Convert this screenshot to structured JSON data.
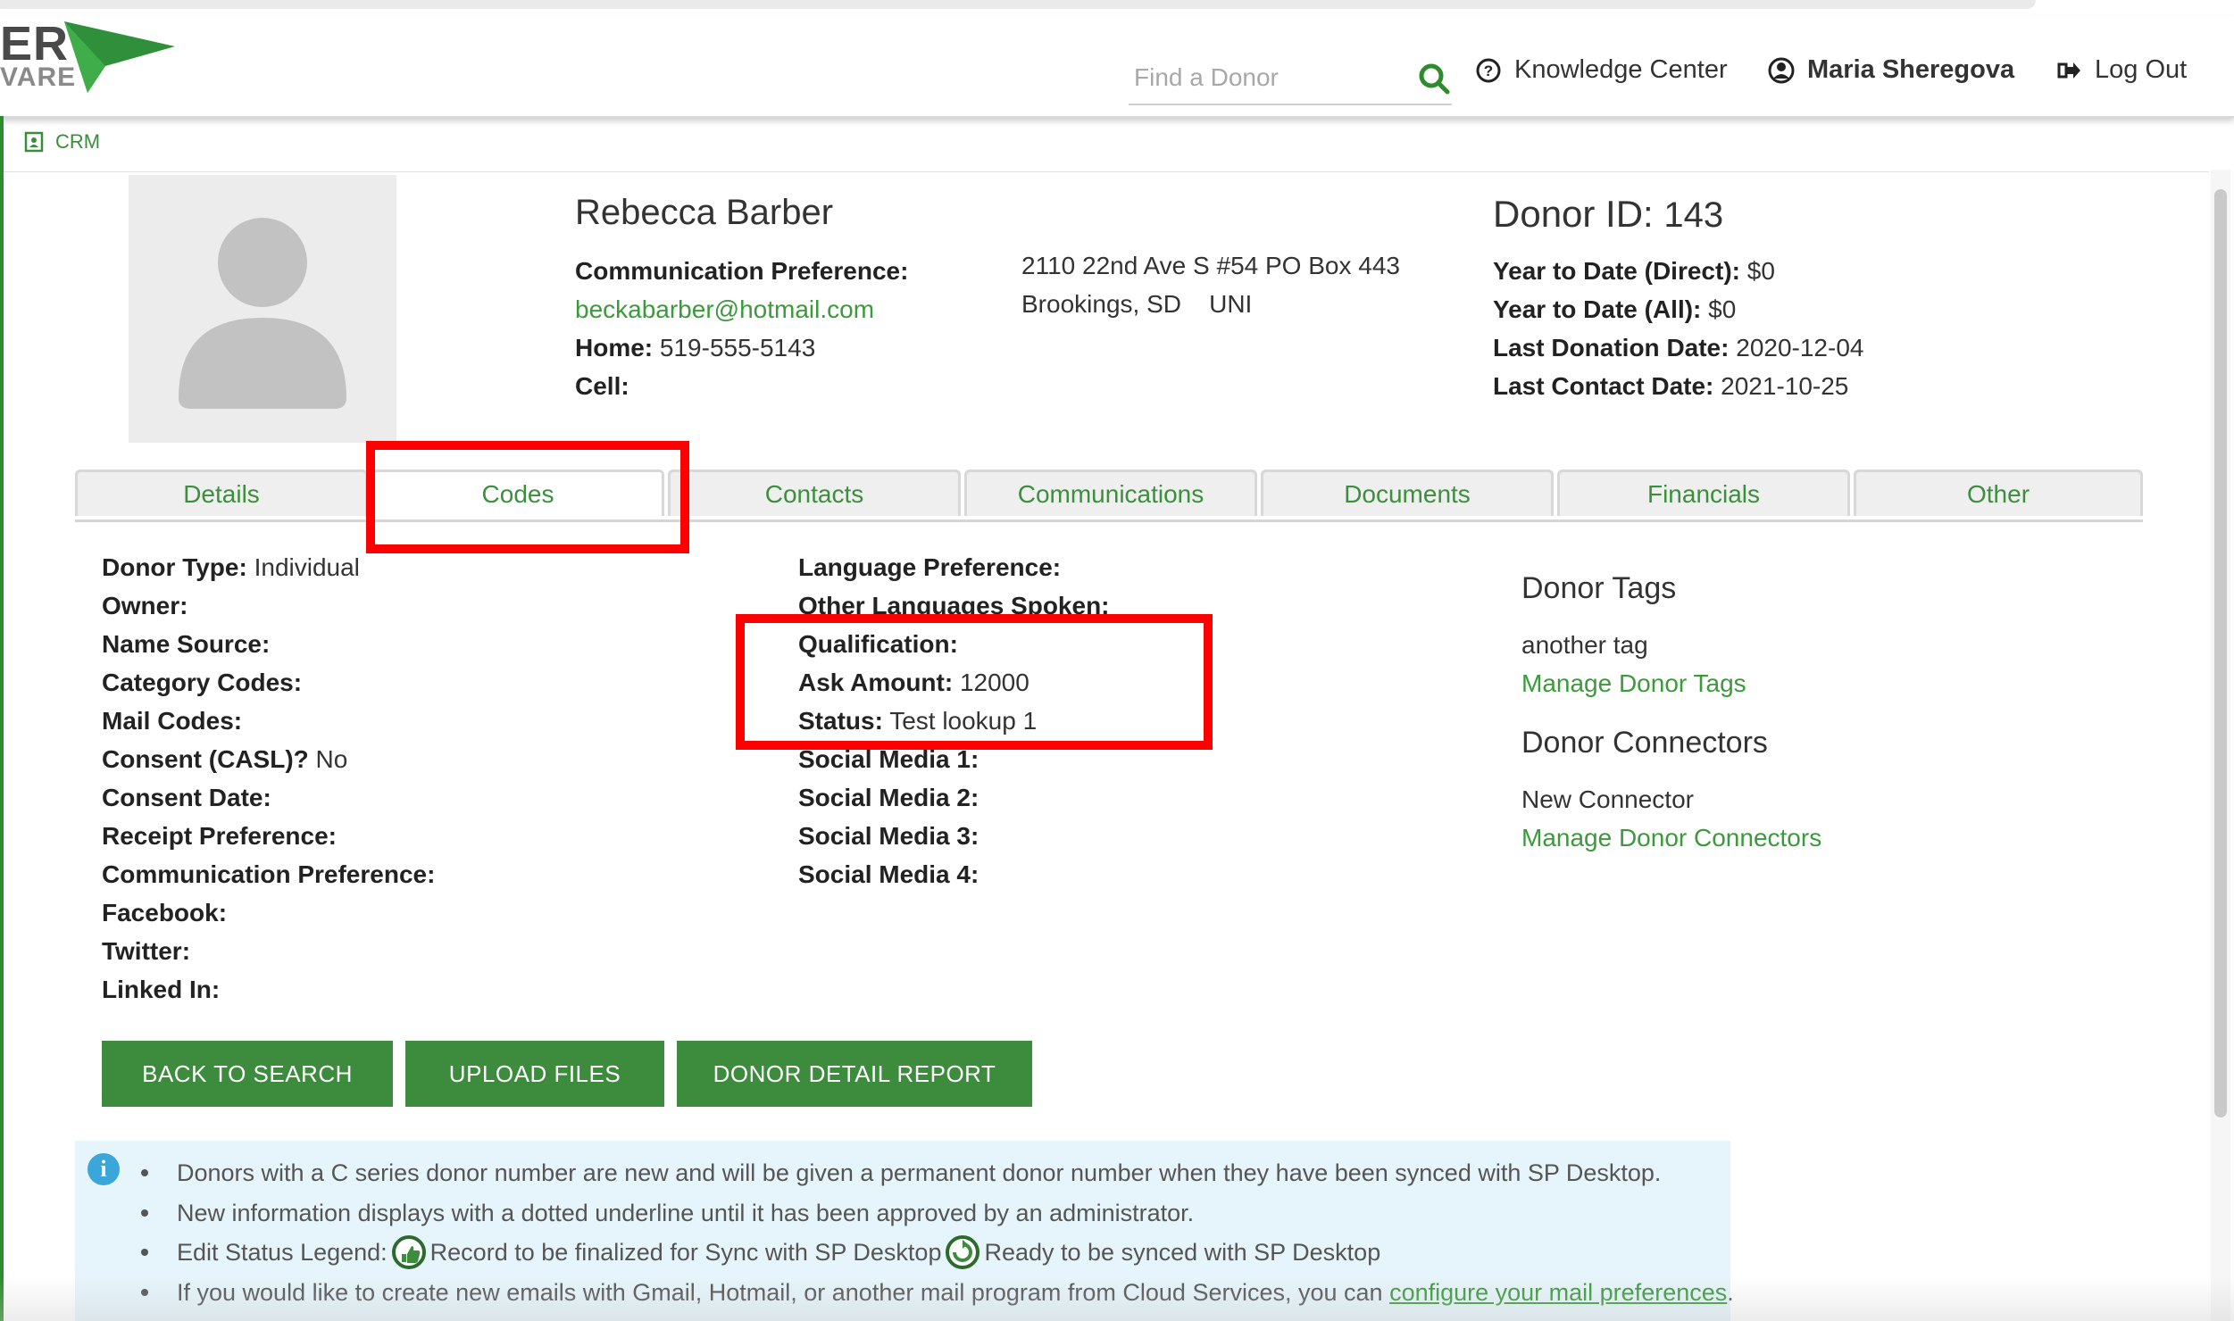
{
  "header": {
    "logo_line1": "ER",
    "logo_line2": "VARE",
    "search_placeholder": "Find a Donor",
    "knowledge_center": "Knowledge Center",
    "user_name": "Maria Sheregova",
    "logout": "Log Out"
  },
  "breadcrumb": {
    "label": "CRM"
  },
  "donor": {
    "name": "Rebecca Barber",
    "comm_pref_label": "Communication Preference:",
    "email": "beckabarber@hotmail.com",
    "home_label": "Home:",
    "home": "519-555-5143",
    "cell_label": "Cell:",
    "address_line1": "2110 22nd Ave S #54 PO Box 443",
    "address_city": "Brookings, SD",
    "address_country": "UNI",
    "id_label": "Donor ID:",
    "id": "143",
    "ytd_direct_label": "Year to Date (Direct):",
    "ytd_direct": "$0",
    "ytd_all_label": "Year to Date (All):",
    "ytd_all": "$0",
    "last_donation_label": "Last Donation Date:",
    "last_donation": "2020-12-04",
    "last_contact_label": "Last Contact Date:",
    "last_contact": "2021-10-25"
  },
  "tabs": [
    "Details",
    "Codes",
    "Contacts",
    "Communications",
    "Documents",
    "Financials",
    "Other"
  ],
  "left_fields": [
    {
      "label": "Donor Type:",
      "value": "Individual"
    },
    {
      "label": "Owner:",
      "value": ""
    },
    {
      "label": "Name Source:",
      "value": ""
    },
    {
      "label": "Category Codes:",
      "value": ""
    },
    {
      "label": "Mail Codes:",
      "value": ""
    },
    {
      "label": "Consent (CASL)?",
      "value": "No"
    },
    {
      "label": "Consent Date:",
      "value": ""
    },
    {
      "label": "Receipt Preference:",
      "value": ""
    },
    {
      "label": "Communication Preference:",
      "value": ""
    },
    {
      "label": "Facebook:",
      "value": ""
    },
    {
      "label": "Twitter:",
      "value": ""
    },
    {
      "label": "Linked In:",
      "value": ""
    }
  ],
  "mid_fields": [
    {
      "label": "Language Preference:",
      "value": ""
    },
    {
      "label": "Other Languages Spoken:",
      "value": ""
    },
    {
      "label": "Qualification:",
      "value": ""
    },
    {
      "label": "Ask Amount:",
      "value": "12000"
    },
    {
      "label": "Status:",
      "value": "Test lookup 1"
    },
    {
      "label": "Social Media 1:",
      "value": ""
    },
    {
      "label": "Social Media 2:",
      "value": ""
    },
    {
      "label": "Social Media 3:",
      "value": ""
    },
    {
      "label": "Social Media 4:",
      "value": ""
    }
  ],
  "tags": {
    "heading": "Donor Tags",
    "items": [
      "another tag"
    ],
    "manage": "Manage Donor Tags"
  },
  "connectors": {
    "heading": "Donor Connectors",
    "items": [
      "New Connector"
    ],
    "manage": "Manage Donor Connectors"
  },
  "buttons": {
    "back": "BACK TO SEARCH",
    "upload": "UPLOAD FILES",
    "report": "DONOR DETAIL REPORT"
  },
  "info": {
    "line1": "Donors with a C series donor number are new and will be given a permanent donor number when they have been synced with SP Desktop.",
    "line2": "New information displays with a dotted underline until it has been approved by an administrator.",
    "line3_prefix": "Edit Status Legend:",
    "line3_a": "Record to be finalized for Sync with SP Desktop",
    "line3_b": "Ready to be synced with SP Desktop",
    "line4_prefix": "If you would like to create new emails with Gmail, Hotmail, or another mail program from Cloud Services, you can",
    "line4_link": "configure your mail preferences",
    "line4_suffix": "."
  },
  "colors": {
    "accent": "#3d8b3d",
    "highlight": "#ff0000",
    "info_bg": "#e6f5fb"
  }
}
